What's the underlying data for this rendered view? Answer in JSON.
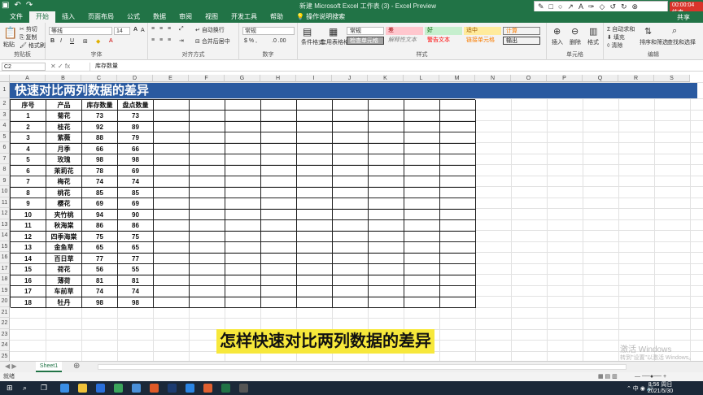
{
  "window": {
    "title": "新建 Microsoft Excel 工作表 (3)  -  Excel Preview",
    "user": "共享",
    "rec_badge": "00:00:04 结束"
  },
  "menu": [
    "文件",
    "开始",
    "插入",
    "页面布局",
    "公式",
    "数据",
    "审阅",
    "视图",
    "开发工具",
    "帮助",
    "操作说明搜索"
  ],
  "ribbon": {
    "clipboard": {
      "paste": "粘贴",
      "cut": "剪切",
      "copy": "复制",
      "format_painter": "格式刷",
      "label": "剪贴板"
    },
    "font": {
      "name": "等线",
      "size": "14",
      "label": "字体"
    },
    "alignment": {
      "wrap": "自动换行",
      "merge": "合并后居中",
      "label": "对齐方式"
    },
    "number": {
      "format": "常规",
      "label": "数字"
    },
    "styles": {
      "cond_format": "条件格式",
      "table_format": "套用表格格式",
      "normal": "常规",
      "bad": "差",
      "good": "好",
      "neutral": "适中",
      "calc": "计算",
      "check_cell": "检查单元格",
      "explain": "解释性文本",
      "warning": "警告文本",
      "linked": "链接单元格",
      "output": "输出",
      "label": "样式"
    },
    "cells": {
      "insert": "插入",
      "delete": "删除",
      "format": "格式",
      "label": "单元格"
    },
    "editing": {
      "autosum": "自动求和",
      "fill": "填充",
      "clear": "清除",
      "sort": "排序和筛选",
      "find": "查找和选择",
      "label": "编辑"
    }
  },
  "formula_bar": {
    "name_box": "C2",
    "fx": "fx",
    "content": "库存数量"
  },
  "columns": [
    "A",
    "B",
    "C",
    "D",
    "E",
    "F",
    "G",
    "H",
    "I",
    "J",
    "K",
    "L",
    "M",
    "N",
    "O",
    "P",
    "Q",
    "R",
    "S"
  ],
  "rows": [
    "1",
    "2",
    "3",
    "4",
    "5",
    "6",
    "7",
    "8",
    "9",
    "10",
    "11",
    "12",
    "13",
    "14",
    "15",
    "16",
    "17",
    "18",
    "19",
    "20",
    "21",
    "22",
    "23",
    "24",
    "25"
  ],
  "banner": "快速对比两列数据的差异",
  "table": {
    "headers": [
      "序号",
      "产品",
      "库存数量",
      "盘点数量"
    ],
    "rows": [
      [
        "1",
        "菊花",
        "73",
        "73"
      ],
      [
        "2",
        "桂花",
        "92",
        "89"
      ],
      [
        "3",
        "紫薇",
        "88",
        "79"
      ],
      [
        "4",
        "月季",
        "66",
        "66"
      ],
      [
        "5",
        "玫瑰",
        "98",
        "98"
      ],
      [
        "6",
        "茉莉花",
        "78",
        "69"
      ],
      [
        "7",
        "梅花",
        "74",
        "74"
      ],
      [
        "8",
        "桃花",
        "85",
        "85"
      ],
      [
        "9",
        "樱花",
        "69",
        "69"
      ],
      [
        "10",
        "夹竹桃",
        "94",
        "90"
      ],
      [
        "11",
        "秋海棠",
        "86",
        "86"
      ],
      [
        "12",
        "四季海棠",
        "75",
        "75"
      ],
      [
        "13",
        "金鱼草",
        "65",
        "65"
      ],
      [
        "14",
        "百日草",
        "77",
        "77"
      ],
      [
        "15",
        "荷花",
        "56",
        "55"
      ],
      [
        "16",
        "薄荷",
        "81",
        "81"
      ],
      [
        "17",
        "车前草",
        "74",
        "74"
      ],
      [
        "18",
        "牡丹",
        "98",
        "98"
      ]
    ]
  },
  "subtitle": "怎样快速对比两列数据的差异",
  "sheet_tab": "Sheet1",
  "status": "就绪",
  "watermark": {
    "line1": "激活 Windows",
    "line2": "转到\"设置\"以激活 Windows。"
  },
  "clock": {
    "time": "8:56 周日",
    "date": "2021/5/30"
  },
  "colors": {
    "excel_green": "#217346",
    "banner_blue": "#2a5aa0",
    "subtitle_yellow": "#f7e83b"
  }
}
